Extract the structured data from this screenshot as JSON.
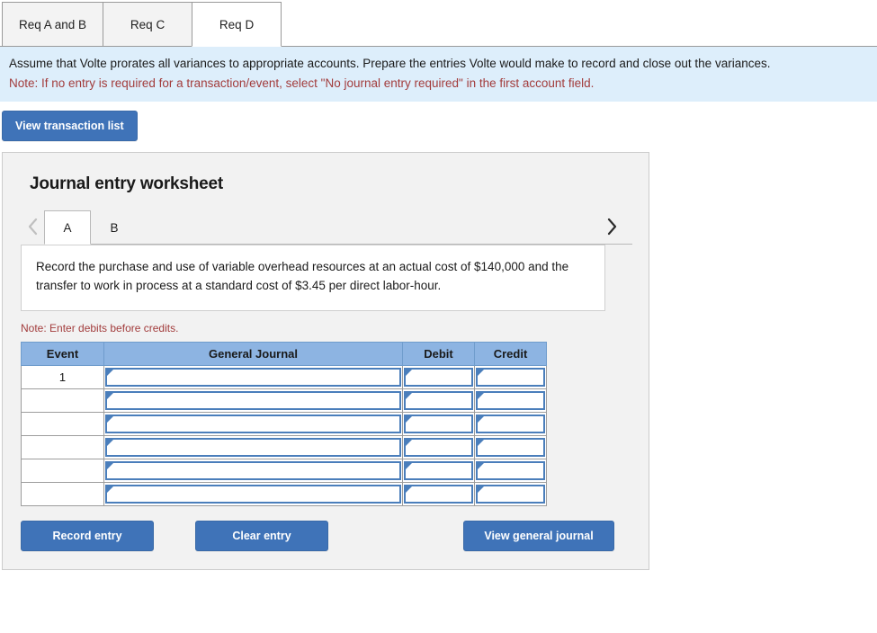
{
  "top_tabs": [
    {
      "label": "Req A and B",
      "active": false
    },
    {
      "label": "Req C",
      "active": false
    },
    {
      "label": "Req D",
      "active": true
    }
  ],
  "banner": {
    "text": "Assume that Volte prorates all variances to appropriate accounts. Prepare the entries Volte would make to record and close out the variances.",
    "note": "Note: If no entry is required for a transaction/event, select \"No journal entry required\" in the first account field."
  },
  "toolbar": {
    "view_transaction_list": "View transaction list"
  },
  "worksheet": {
    "title": "Journal entry worksheet",
    "nav": {
      "prev_icon": "chevron-left-icon",
      "next_icon": "chevron-right-icon"
    },
    "entry_tabs": [
      {
        "label": "A",
        "active": true
      },
      {
        "label": "B",
        "active": false
      }
    ],
    "description": "Record the purchase and use of variable overhead resources at an actual cost of $140,000 and the transfer to work in process at a standard cost of $3.45 per direct labor-hour.",
    "debit_note": "Note: Enter debits before credits.",
    "table": {
      "columns": [
        "Event",
        "General Journal",
        "Debit",
        "Credit"
      ],
      "rows": [
        {
          "event": "1",
          "general_journal": "",
          "debit": "",
          "credit": ""
        },
        {
          "event": "",
          "general_journal": "",
          "debit": "",
          "credit": ""
        },
        {
          "event": "",
          "general_journal": "",
          "debit": "",
          "credit": ""
        },
        {
          "event": "",
          "general_journal": "",
          "debit": "",
          "credit": ""
        },
        {
          "event": "",
          "general_journal": "",
          "debit": "",
          "credit": ""
        },
        {
          "event": "",
          "general_journal": "",
          "debit": "",
          "credit": ""
        }
      ]
    },
    "buttons": {
      "record_entry": "Record entry",
      "clear_entry": "Clear entry",
      "view_general_journal": "View general journal"
    }
  },
  "colors": {
    "accent_blue": "#3f73b8",
    "table_header_blue": "#8db4e2",
    "cell_border_blue": "#4a7ebb",
    "banner_bg": "#ddeefb",
    "note_red": "#a23c3c",
    "panel_bg": "#f2f2f2"
  }
}
